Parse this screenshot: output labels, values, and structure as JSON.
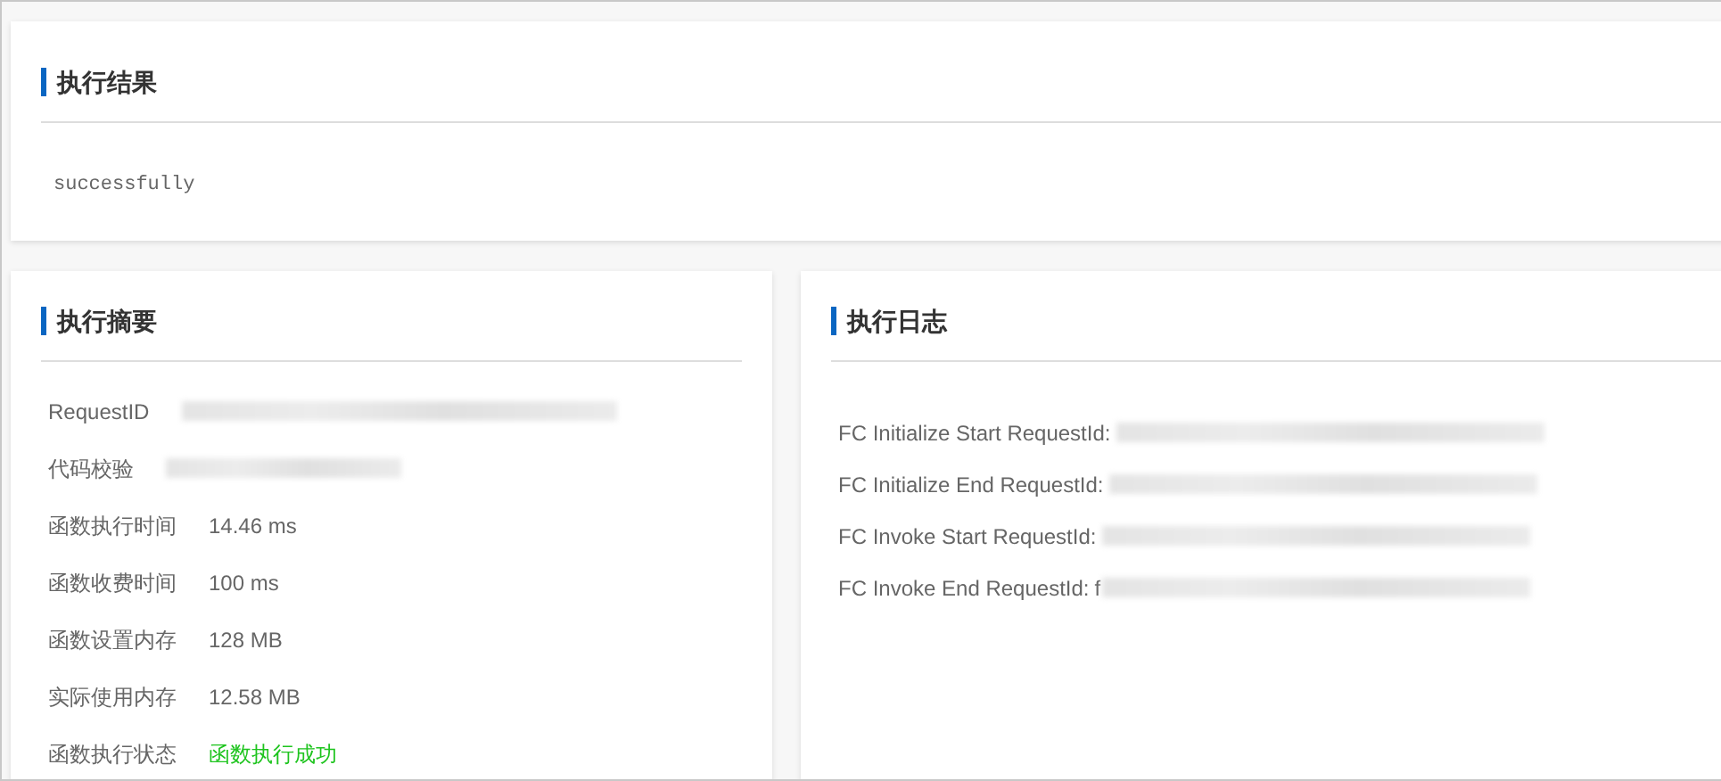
{
  "result": {
    "title": "执行结果",
    "output": "successfully"
  },
  "summary": {
    "title": "执行摘要",
    "rows": [
      {
        "kind": "redacted",
        "label": "RequestID"
      },
      {
        "kind": "redacted",
        "label": "代码校验"
      },
      {
        "kind": "text",
        "label": "函数执行时间",
        "value": "14.46 ms"
      },
      {
        "kind": "text",
        "label": "函数收费时间",
        "value": "100 ms"
      },
      {
        "kind": "text",
        "label": "函数设置内存",
        "value": "128 MB"
      },
      {
        "kind": "text",
        "label": "实际使用内存",
        "value": "12.58 MB"
      },
      {
        "kind": "status",
        "label": "函数执行状态",
        "value": "函数执行成功",
        "color": "#1ec41e"
      }
    ]
  },
  "log": {
    "title": "执行日志",
    "lines": [
      {
        "label": "FC Initialize Start RequestId:"
      },
      {
        "label": "FC Initialize End RequestId:"
      },
      {
        "label": "FC Invoke Start RequestId:"
      },
      {
        "label": "FC Invoke End RequestId:",
        "value_prefix": "f"
      }
    ]
  }
}
